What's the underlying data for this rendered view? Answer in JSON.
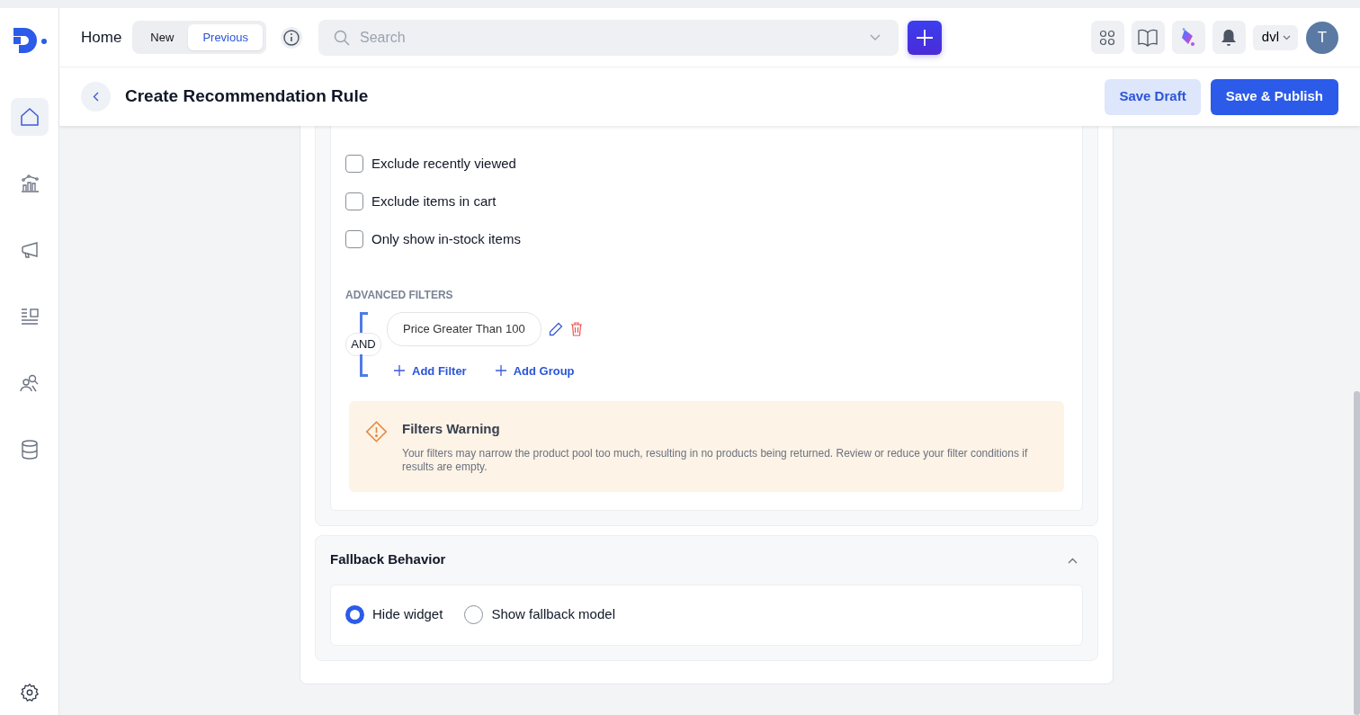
{
  "sidebar": {
    "items": [
      {
        "kind": "home",
        "selected": true
      },
      {
        "kind": "analytics",
        "selected": false
      },
      {
        "kind": "campaigns",
        "selected": false
      },
      {
        "kind": "content",
        "selected": false
      },
      {
        "kind": "audience",
        "selected": false
      },
      {
        "kind": "data",
        "selected": false
      }
    ],
    "footer": {
      "kind": "settings"
    }
  },
  "topbar": {
    "title": "Home",
    "toggle": [
      {
        "label": "New",
        "selected": false
      },
      {
        "label": "Previous",
        "selected": true
      }
    ],
    "search": {
      "placeholder": "Search"
    },
    "workspace": "dvl",
    "avatar_initial": "T"
  },
  "page": {
    "title": "Create Recommendation Rule",
    "buttons": [
      {
        "label": "Save Draft",
        "kind": "secondary"
      },
      {
        "label": "Save & Publish",
        "kind": "primary"
      }
    ]
  },
  "options": [
    {
      "label": "Exclude recently viewed",
      "checked": false
    },
    {
      "label": "Exclude items in cart",
      "checked": false
    },
    {
      "label": "Only show in-stock items",
      "checked": false
    }
  ],
  "advanced_filters": {
    "heading": "ADVANCED FILTERS",
    "operator": "AND",
    "filters": [
      {
        "label": "Price Greater Than 100"
      }
    ],
    "actions": [
      "Add Filter",
      "Add Group"
    ]
  },
  "warning": {
    "title": "Filters Warning",
    "message": "Your filters may narrow the product pool too much, resulting in no products being returned. Review or reduce your filter conditions if results are empty."
  },
  "fallback": {
    "title": "Fallback Behavior",
    "expanded": true,
    "options": [
      {
        "label": "Hide widget",
        "selected": true
      },
      {
        "label": "Show fallback model",
        "selected": false
      }
    ]
  }
}
